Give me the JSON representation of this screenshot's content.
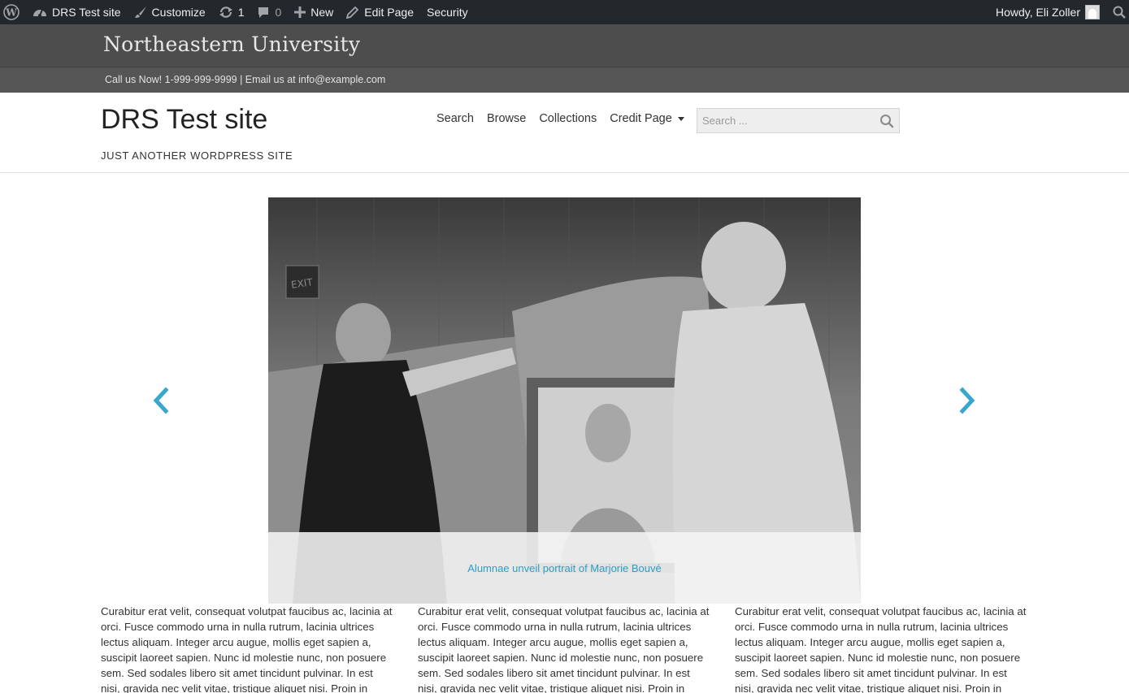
{
  "adminbar": {
    "site_name": "DRS Test site",
    "customize": "Customize",
    "updates_count": "1",
    "comments_count": "0",
    "new": "New",
    "edit_page": "Edit Page",
    "security": "Security",
    "howdy": "Howdy, Eli Zoller"
  },
  "brand": {
    "name": "Northeastern University",
    "contact": "Call us Now! 1-999-999-9999 | Email us at info@example.com"
  },
  "header": {
    "site_title": "DRS Test site",
    "tagline": "JUST ANOTHER WORDPRESS SITE",
    "nav": [
      "Search",
      "Browse",
      "Collections",
      "Credit Page"
    ],
    "search_placeholder": "Search ..."
  },
  "carousel": {
    "caption": "Alumnae unveil portrait of Marjorie Bouvé",
    "exit_sign": "EXIT"
  },
  "columns": [
    "Curabitur erat velit, consequat volutpat faucibus ac, lacinia at orci. Fusce commodo urna in nulla rutrum, lacinia ultrices lectus aliquam. Integer arcu augue, mollis eget sapien a, suscipit laoreet sapien. Nunc id molestie nunc, non posuere sem. Sed sodales libero sit amet tincidunt pulvinar. In est nisi, gravida nec velit vitae, tristique aliquet nisi. Proin in lacus at",
    "Curabitur erat velit, consequat volutpat faucibus ac, lacinia at orci. Fusce commodo urna in nulla rutrum, lacinia ultrices lectus aliquam. Integer arcu augue, mollis eget sapien a, suscipit laoreet sapien. Nunc id molestie nunc, non posuere sem. Sed sodales libero sit amet tincidunt pulvinar. In est nisi, gravida nec velit vitae, tristique aliquet nisi. Proin in lacus at",
    "Curabitur erat velit, consequat volutpat faucibus ac, lacinia at orci. Fusce commodo urna in nulla rutrum, lacinia ultrices lectus aliquam. Integer arcu augue, mollis eget sapien a, suscipit laoreet sapien. Nunc id molestie nunc, non posuere sem. Sed sodales libero sit amet tincidunt pulvinar. In est nisi, gravida nec velit vitae, tristique aliquet nisi. Proin in lacus at"
  ],
  "icons": {
    "wordpress": "wordpress-logo-icon",
    "dashboard": "dashboard-gauge-icon",
    "customize": "paintbrush-icon",
    "updates": "refresh-icon",
    "comments": "speech-bubble-icon",
    "new": "plus-icon",
    "edit": "pencil-icon",
    "search": "magnifier-icon",
    "prev": "chevron-left-icon",
    "next": "chevron-right-icon"
  },
  "colors": {
    "adminbar_bg": "#23282d",
    "brandbar_bg": "#4d4d4d",
    "contactbar_bg": "#555555",
    "accent": "#2a9fc4"
  }
}
